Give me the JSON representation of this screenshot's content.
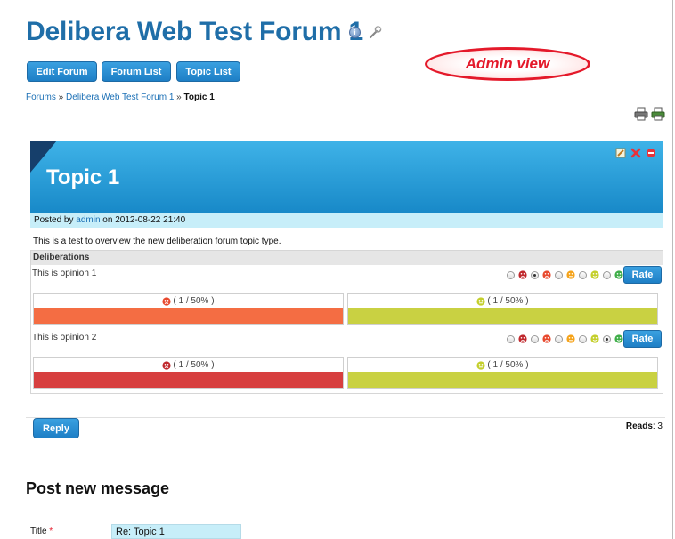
{
  "header": {
    "forum_title": "Delibera Web Test Forum 1",
    "admin_badge": "Admin view"
  },
  "toolbar": {
    "edit_forum": "Edit Forum",
    "forum_list": "Forum List",
    "topic_list": "Topic List"
  },
  "breadcrumb": {
    "root": "Forums",
    "sep1": " » ",
    "forum": "Delibera Web Test Forum 1",
    "sep2": " » ",
    "current": "Topic 1"
  },
  "topic": {
    "title": "Topic 1",
    "posted_prefix": "Posted by ",
    "author": "admin",
    "posted_on": " on 2012-08-22 21:40",
    "body": "This is a test to overview the new deliberation forum topic type."
  },
  "deliberations": {
    "heading": "Deliberations",
    "rate_label": "Rate",
    "opinions": [
      {
        "text": "This is opinion 1",
        "selected_index": 1,
        "results": [
          {
            "label": "( 1 / 50% )",
            "percent": 50,
            "color": "#f46d43",
            "icon": "unhappy-red-icon"
          },
          {
            "label": "( 1 / 50% )",
            "percent": 50,
            "color": "#c9d142",
            "icon": "smile-yellow-green-icon"
          }
        ]
      },
      {
        "text": "This is opinion 2",
        "selected_index": 4,
        "results": [
          {
            "label": "( 1 / 50% )",
            "percent": 50,
            "color": "#d73f3f",
            "icon": "very-unhappy-icon"
          },
          {
            "label": "( 1 / 50% )",
            "percent": 50,
            "color": "#c9d142",
            "icon": "smile-yellow-green-icon"
          }
        ]
      }
    ],
    "scale_colors": [
      "#c0282d",
      "#e8492e",
      "#f5a31a",
      "#c4cf2c",
      "#3fae49"
    ]
  },
  "footer": {
    "reply": "Reply",
    "reads_label": "Reads",
    "reads_value": ": 3"
  },
  "post_form": {
    "heading": "Post new message",
    "title_label": "Title",
    "required_mark": " *",
    "title_value": "Re: Topic 1"
  }
}
